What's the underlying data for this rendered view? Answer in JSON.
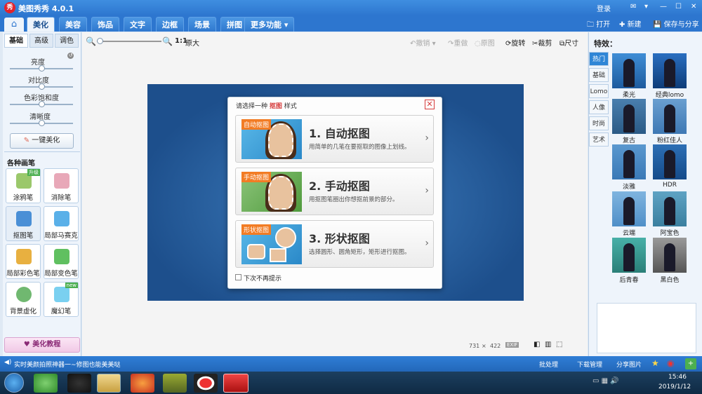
{
  "app": {
    "title": "美图秀秀 4.0.1",
    "logo_text": "秀",
    "login": "登录"
  },
  "titlebar_icons": [
    "message-icon",
    "menu-icon",
    "minimize-icon",
    "maximize-icon",
    "close-icon"
  ],
  "tabs": [
    {
      "label": "美化",
      "active": true
    },
    {
      "label": "美容"
    },
    {
      "label": "饰品"
    },
    {
      "label": "文字"
    },
    {
      "label": "边框"
    },
    {
      "label": "场景"
    },
    {
      "label": "拼图"
    },
    {
      "label": "更多功能 ▾"
    }
  ],
  "topbuttons": {
    "open": "打开",
    "new": "新建",
    "save": "保存与分享"
  },
  "left": {
    "subtabs": [
      "基础",
      "高级",
      "调色"
    ],
    "sliders": [
      "亮度",
      "对比度",
      "色彩饱和度",
      "清晰度"
    ],
    "one_click": "一键美化",
    "brush_title": "各种画笔",
    "tools": [
      {
        "label": "涂鸦笔",
        "badge": "升级",
        "color": "#9bc86b"
      },
      {
        "label": "消除笔",
        "color": "#e8a8b8"
      },
      {
        "label": "抠图笔",
        "color": "#4a8fd6"
      },
      {
        "label": "局部马赛克",
        "color": "#5ab0e8"
      },
      {
        "label": "局部彩色笔",
        "color": "#e8b040"
      },
      {
        "label": "局部变色笔",
        "color": "#60c060"
      },
      {
        "label": "背景虚化",
        "color": "#70b870"
      },
      {
        "label": "魔幻笔",
        "badge": "new",
        "color": "#7ad0f0"
      }
    ],
    "tutorial": "美化教程"
  },
  "toolbar": {
    "zoom_ratio": "1:1",
    "original": "原大",
    "undo": "撤销",
    "redo": "重做",
    "restore": "原图",
    "rotate": "旋转",
    "crop": "裁剪",
    "size": "尺寸"
  },
  "dialog": {
    "prompt_before": "请选择一种",
    "prompt_key": "抠图",
    "prompt_after": "样式",
    "options": [
      {
        "tag": "自动抠图",
        "title": "1. 自动抠图",
        "desc": "用简单的几笔在要抠取的图像上划线。"
      },
      {
        "tag": "手动抠图",
        "title": "2. 手动抠图",
        "desc": "用抠图笔圈出你想抠前景的部分。"
      },
      {
        "tag": "形状抠图",
        "title": "3. 形状抠图",
        "desc": "选择圆形、圆角矩形，矩形进行抠图。"
      }
    ],
    "checkbox": "下次不再提示"
  },
  "image_info": {
    "width": "731",
    "times": "×",
    "height": "422",
    "exif": "EXIF"
  },
  "right": {
    "title": "特效：",
    "tabs": [
      "热门",
      "基础",
      "Lomo",
      "人像",
      "时尚",
      "艺术"
    ],
    "effects": [
      {
        "label": "柔光"
      },
      {
        "label": "经典lomo"
      },
      {
        "label": "复古"
      },
      {
        "label": "粉红佳人"
      },
      {
        "label": "淡雅"
      },
      {
        "label": "HDR"
      },
      {
        "label": "云端"
      },
      {
        "label": "阿宝色"
      },
      {
        "label": "后青春"
      },
      {
        "label": "黑白色"
      }
    ]
  },
  "status": {
    "left": "实时美颜拍照神器一~修图也能美美哒",
    "batch": "批处理",
    "download": "下载管理",
    "share": "分享图片"
  },
  "taskbar": {
    "time": "15:46",
    "date": "2019/1/12",
    "items": [
      "start-icon",
      "360-icon",
      "qq-icon",
      "explorer-icon",
      "firefox-icon",
      "video-icon",
      "record-icon",
      "meitu-icon"
    ]
  },
  "colors": {
    "accent": "#2d76cf",
    "dialog_close": "#d63b3b",
    "tag_orange": "#f27c24"
  }
}
